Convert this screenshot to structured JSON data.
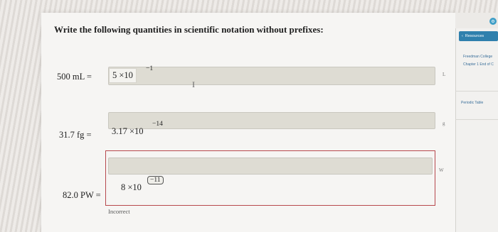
{
  "question": {
    "title": "Write the following quantities in scientific notation without prefixes:"
  },
  "rows": [
    {
      "label": "500 mL =",
      "mantissa_text": "5  ×10",
      "exponent": "−1",
      "side_letter": "L"
    },
    {
      "label": "31.7 fg =",
      "mantissa_text": "3.17  ×10",
      "exponent": "−14",
      "side_letter": "g"
    },
    {
      "label": "82.0 PW =",
      "mantissa_text": "8  ×10",
      "exponent": "−11",
      "side_letter": "W",
      "status": "Incorrect"
    }
  ],
  "cursor_glyph": "I",
  "sidebar": {
    "resources_label": "Resources",
    "link1": "Freedman College",
    "link2": "Chapter 1 End of C",
    "link3": "Periodic Table",
    "corner_icon": "⚙"
  },
  "colors": {
    "incorrect_outline": "#b7484d",
    "resources_button": "#2f80ad"
  }
}
